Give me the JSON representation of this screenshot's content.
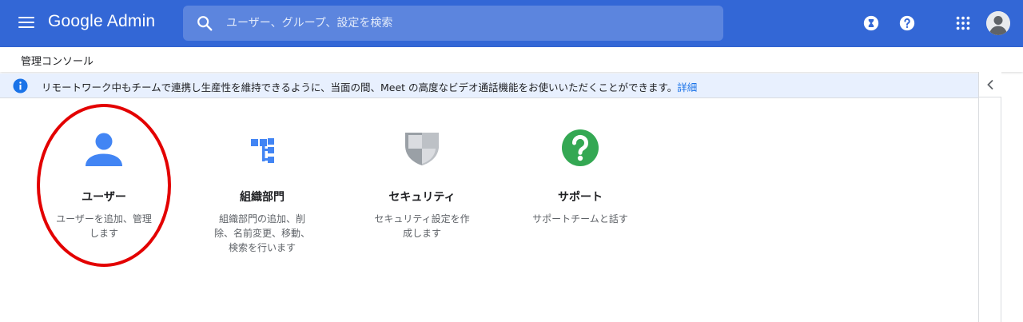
{
  "header": {
    "brand": "Google Admin",
    "search_placeholder": "ユーザー、グループ、設定を検索",
    "icons": [
      "menu-icon",
      "search-icon",
      "hourglass-icon",
      "help-icon",
      "apps-grid-icon",
      "account-avatar-icon"
    ]
  },
  "breadcrumb": {
    "label": "管理コンソール"
  },
  "notice": {
    "text": "リモートワーク中もチームで連携し生産性を維持できるように、当面の間、Meet の高度なビデオ通話機能をお使いいただくことができます。",
    "link": "詳細"
  },
  "cards": [
    {
      "title": "ユーザー",
      "desc": "ユーザーを追加、管理します",
      "icon": "person-icon"
    },
    {
      "title": "組織部門",
      "desc": "組織部門の追加、削除、名前変更、移動、検索を行います",
      "icon": "org-tree-icon"
    },
    {
      "title": "セキュリティ",
      "desc": "セキュリティ設定を作成します",
      "icon": "shield-icon"
    },
    {
      "title": "サポート",
      "desc": "サポートチームと話す",
      "icon": "help-circle-icon"
    }
  ],
  "colors": {
    "header_bg": "#3367d6",
    "search_bg": "#5c85de",
    "accent_blue": "#4285f4",
    "support_green": "#34a853",
    "highlight_red": "#e30000",
    "notice_bg": "#e8f0fe"
  }
}
